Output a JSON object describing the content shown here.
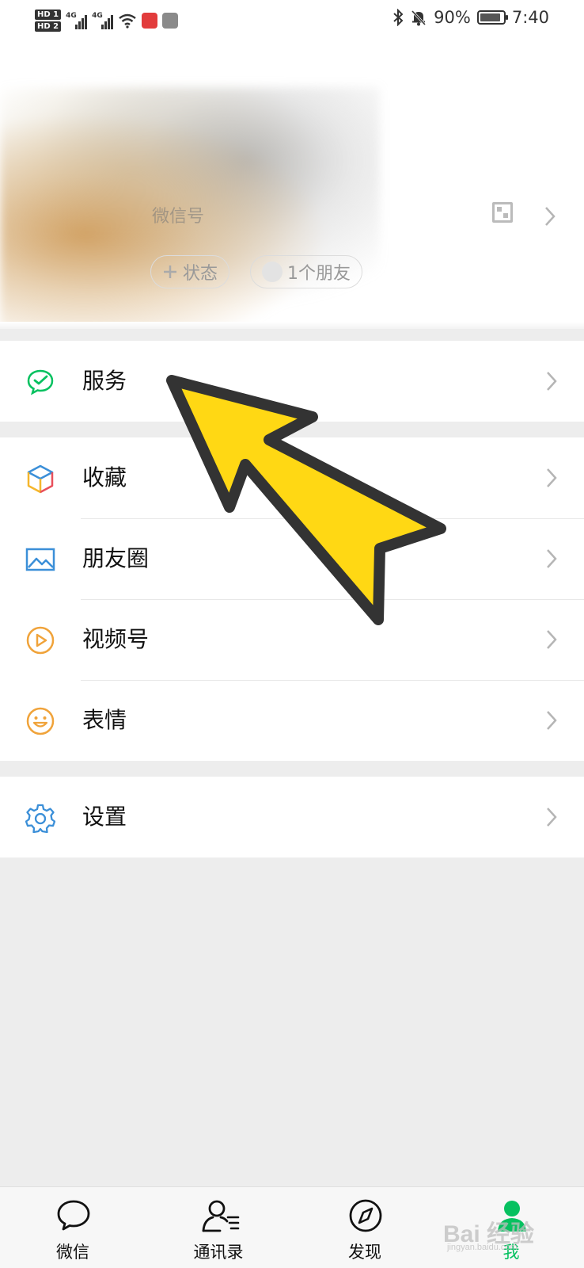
{
  "status_bar": {
    "hd1": "HD 1",
    "hd2": "HD 2",
    "net1": "4G",
    "net2": "4G",
    "battery_level": 0.9,
    "battery_text": "90%",
    "time": "7:40"
  },
  "profile": {
    "wechat_id_label": "微信号",
    "status_button": "状态",
    "friends_text": "1个朋友"
  },
  "menu": {
    "service": "服务",
    "favorites": "收藏",
    "moments": "朋友圈",
    "channels": "视频号",
    "stickers": "表情",
    "settings": "设置"
  },
  "tabs": {
    "chats": "微信",
    "contacts": "通讯录",
    "discover": "发现",
    "me": "我"
  },
  "watermark": {
    "brand": "Bai  经验",
    "url": "jingyan.baidu.com"
  },
  "colors": {
    "accent": "#07c160",
    "annotation_fill": "#ffd814",
    "annotation_stroke": "#333333"
  }
}
